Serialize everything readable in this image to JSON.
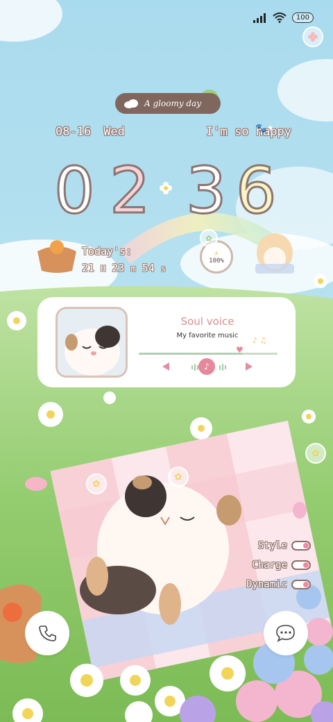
{
  "status_bar": {
    "battery": "100",
    "icons": [
      "signal-icon",
      "wifi-icon"
    ]
  },
  "weather": {
    "text": "A gloomy day",
    "icon": "cloud-icon"
  },
  "date": {
    "date": "08-16",
    "weekday": "Wed",
    "mood": "I'm so happy"
  },
  "clock": {
    "h1": "0",
    "h2": "2",
    "m1": "3",
    "m2": "6"
  },
  "countdown": {
    "label": "Today's:",
    "hours": "21",
    "h_unit": "H",
    "minutes": "23",
    "m_unit": "m",
    "seconds": "54",
    "s_unit": "s"
  },
  "battery_widget": {
    "value": "100%"
  },
  "music": {
    "title": "Soul voice",
    "subtitle": "My favorite music",
    "progress": 0.75
  },
  "toggles": [
    {
      "label": "Style"
    },
    {
      "label": "Charge"
    },
    {
      "label": "Dynamic"
    }
  ],
  "dock": {
    "left_icon": "phone-icon",
    "right_icon": "message-icon"
  },
  "colors": {
    "accent_pink": "#e6879b",
    "pill_brown": "#7f675e",
    "progress_green": "#b5cdb6"
  }
}
